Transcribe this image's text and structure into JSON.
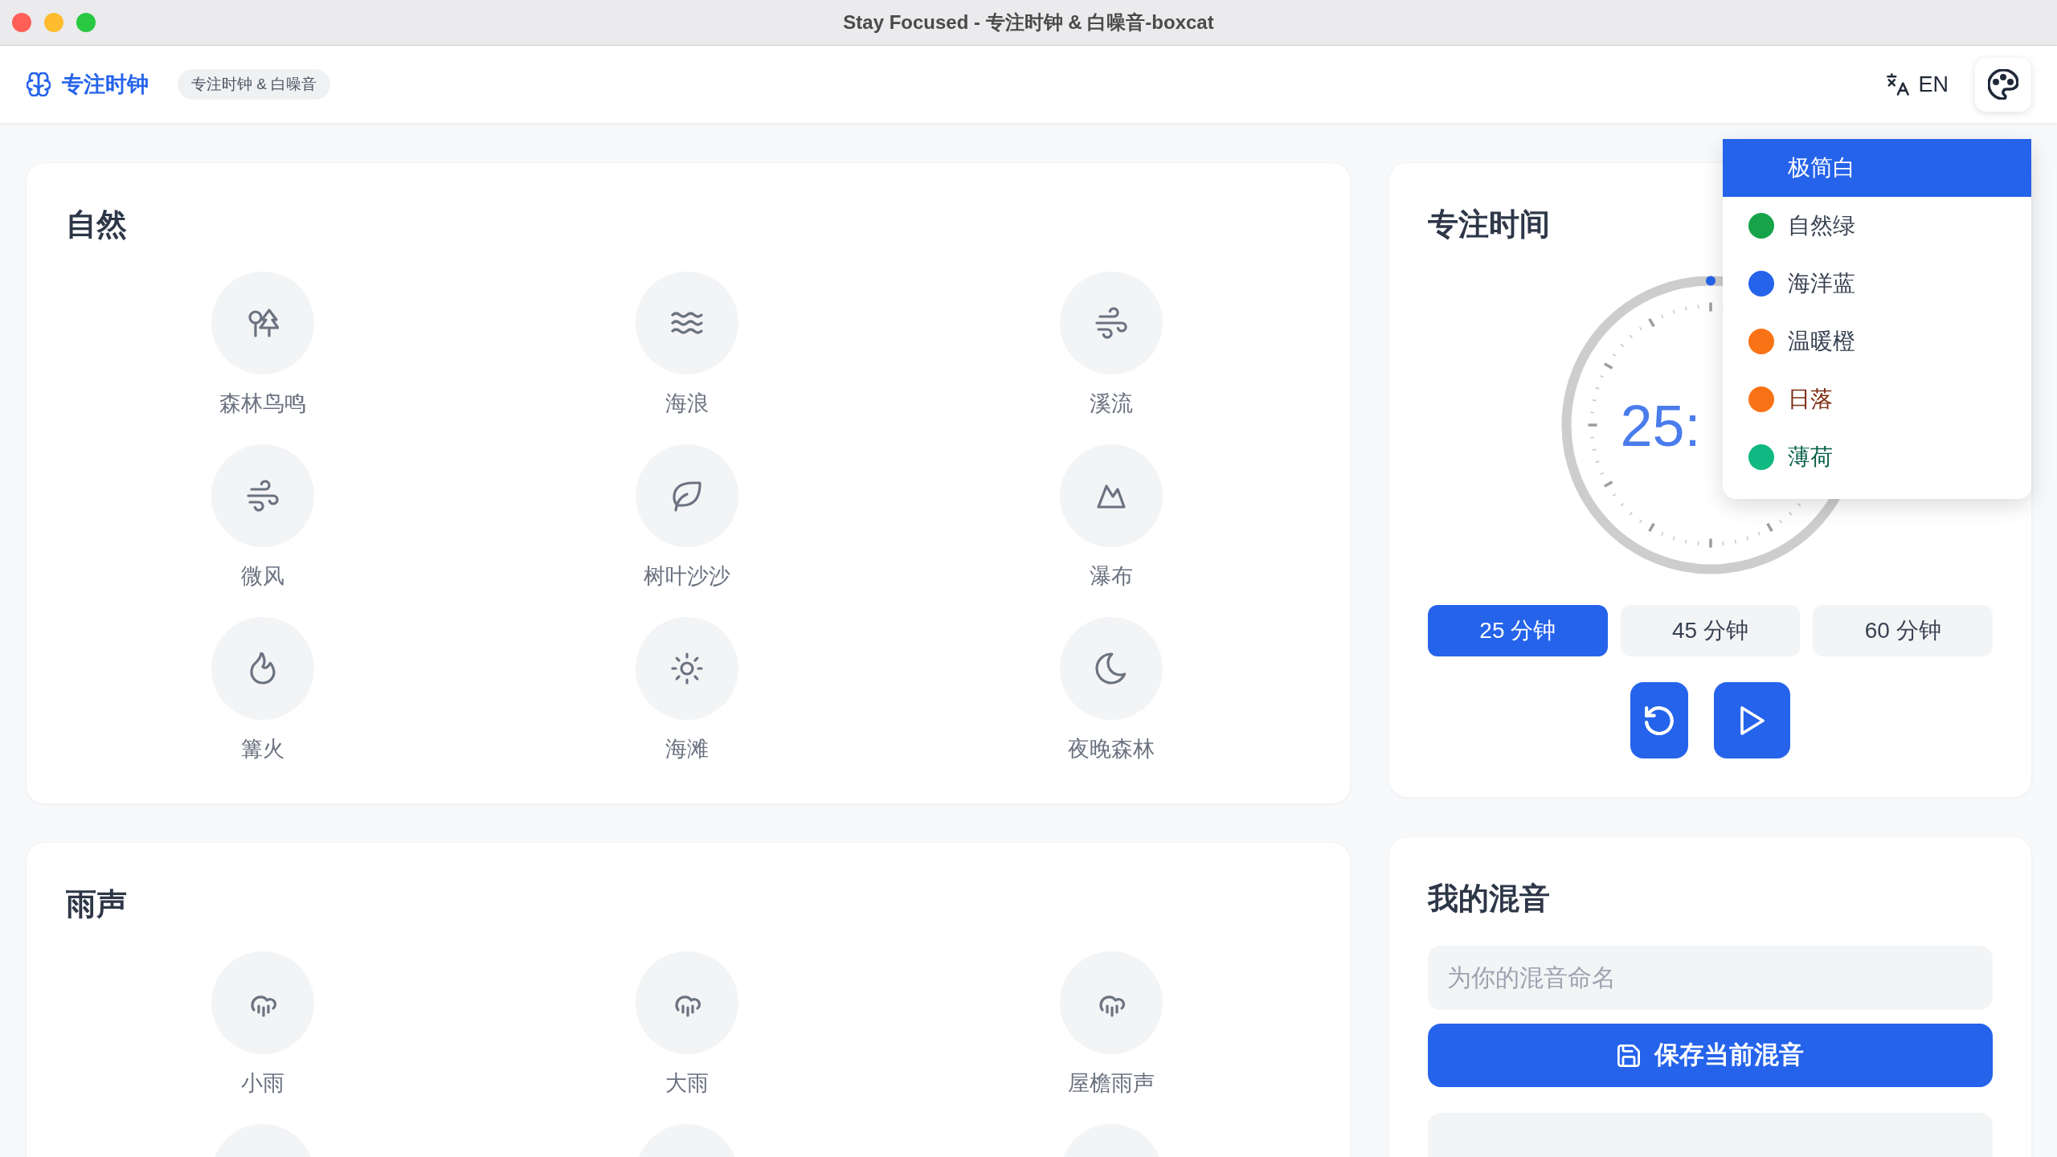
{
  "window": {
    "title": "Stay Focused - 专注时钟 & 白噪音-boxcat"
  },
  "navbar": {
    "app_name": "专注时钟",
    "badge": "专注时钟 & 白噪音",
    "language_button": "EN"
  },
  "theme_menu": {
    "items": [
      {
        "label": {
          "text": "极简白"
        },
        "selected": true
      },
      {
        "label": {
          "text": "自然绿"
        },
        "selected": false,
        "color": "#16a34a"
      },
      {
        "label": {
          "text": "海洋蓝"
        },
        "selected": false,
        "color": "#2563eb"
      },
      {
        "label": {
          "text": "温暖橙"
        },
        "selected": false,
        "color": "#f97316"
      },
      {
        "label": {
          "text": "日落",
          "color": "#7c2d12"
        },
        "selected": false,
        "color": "#f97316"
      },
      {
        "label": {
          "text": "薄荷",
          "color": "#065f46"
        },
        "selected": false,
        "color": "#10b981"
      }
    ]
  },
  "sections": [
    {
      "title": "自然",
      "items": [
        {
          "label": "森林鸟鸣"
        },
        {
          "label": "海浪"
        },
        {
          "label": "溪流"
        },
        {
          "label": "微风"
        },
        {
          "label": "树叶沙沙"
        },
        {
          "label": "瀑布"
        },
        {
          "label": "篝火"
        },
        {
          "label": "海滩"
        },
        {
          "label": "夜晚森林"
        }
      ]
    },
    {
      "title": "雨声",
      "items": [
        {
          "kind": "sound",
          "label": "小雨"
        },
        {
          "kind": "sound",
          "label": "大雨"
        },
        {
          "kind": "sound",
          "label": "屋檐雨声"
        },
        {
          "kind": "clipped"
        },
        {
          "kind": "clipped"
        },
        {
          "kind": "clipped"
        }
      ]
    }
  ],
  "timer": {
    "title": "专注时间",
    "time": "25:",
    "presets": [
      {
        "label": "25 分钟",
        "selected": true
      },
      {
        "label": "45 分钟",
        "selected": false
      },
      {
        "label": "60 分钟",
        "selected": false
      }
    ]
  },
  "mix": {
    "title": "我的混音",
    "name_field": {
      "placeholder": "为你的混音命名"
    },
    "save_button": "保存当前混音"
  }
}
